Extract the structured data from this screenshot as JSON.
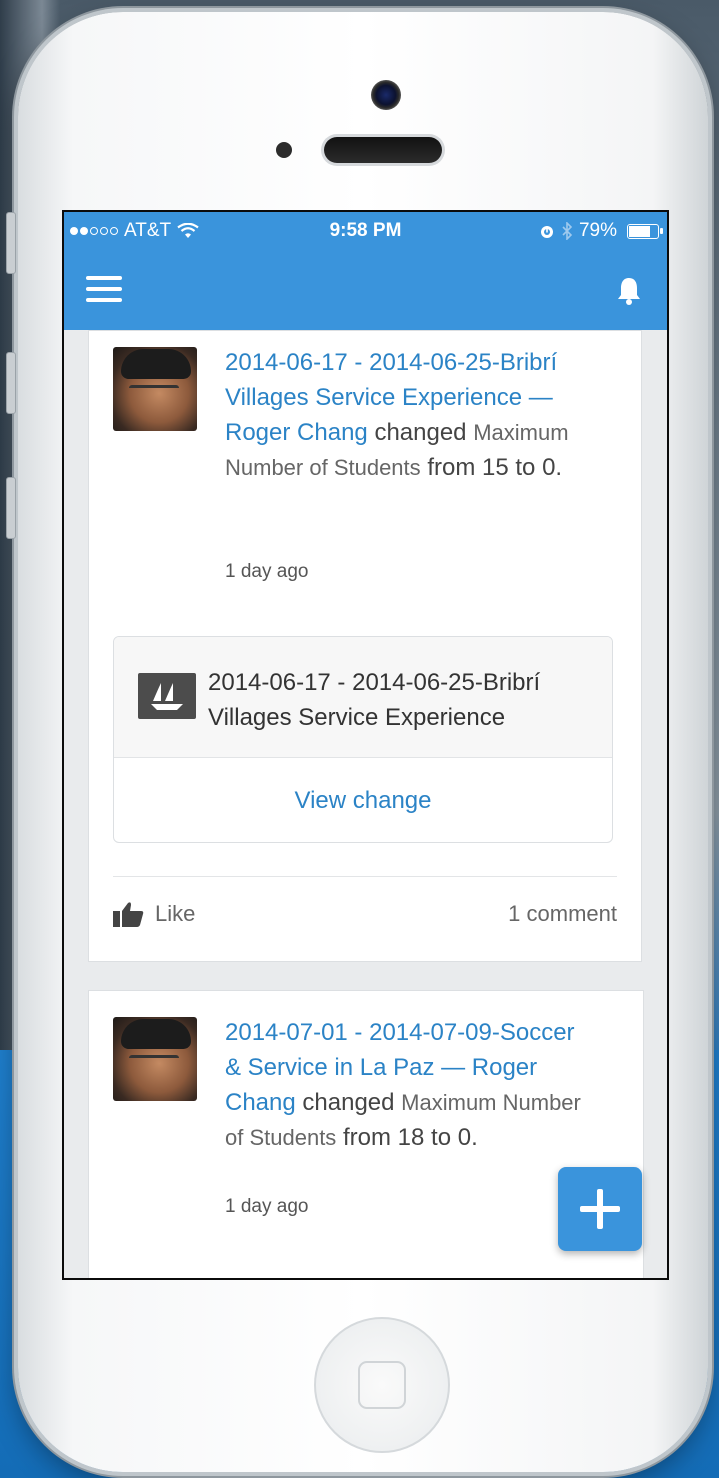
{
  "status_bar": {
    "carrier": "AT&T",
    "time": "9:58 PM",
    "battery": "79%",
    "battery_level": 0.79
  },
  "feed": [
    {
      "record_link": "2014-06-17 - 2014-06-25-Bribrí Villages Service Experience",
      "separator": "—",
      "user": "Roger Chang",
      "action": "changed",
      "field": "Maximum Number of Students",
      "from_label": "from",
      "from_value": "15",
      "to_label": "to",
      "to_value": "0.",
      "time_ago": "1 day ago",
      "record_box_title": "2014-06-17 - 2014-06-25-Bribrí Villages Service Experience",
      "view_change": "View change",
      "like_label": "Like",
      "comments": "1 comment"
    },
    {
      "record_link": "2014-07-01 - 2014-07-09-Soccer & Service in La Paz",
      "separator": "—",
      "user": "Roger Chang",
      "action": "changed",
      "field": "Maximum Number of Students",
      "from_label": "from",
      "from_value": "18",
      "to_label": "to",
      "to_value": "0.",
      "time_ago": "1 day ago"
    }
  ],
  "icons": {
    "menu": "hamburger-menu-icon",
    "notifications": "bell-icon",
    "record": "ship-logo-icon",
    "like": "thumbs-up-icon",
    "add": "plus-icon"
  },
  "colors": {
    "brand_blue": "#3a94dc",
    "link_blue": "#2b83c6"
  }
}
